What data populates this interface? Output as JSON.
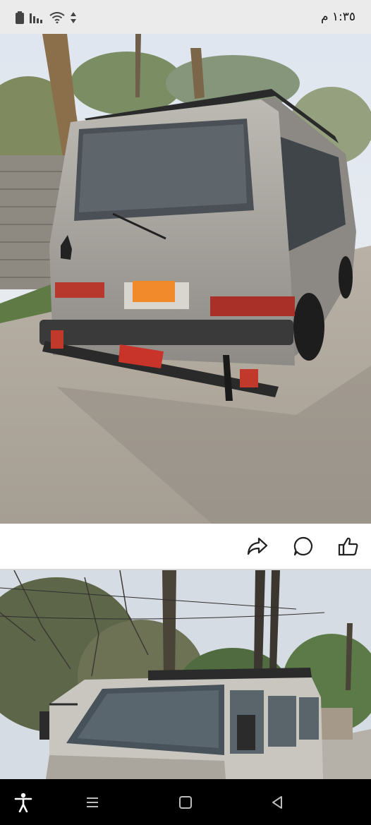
{
  "status_bar": {
    "time": "١:٣٥ م",
    "icons": [
      "battery-icon",
      "signal-icon",
      "wifi-icon",
      "data-arrows-icon"
    ]
  },
  "post_actions": {
    "icons": [
      "share-icon",
      "comment-icon",
      "like-icon"
    ]
  },
  "nav_bar": {
    "icons": [
      "accessibility-icon",
      "recent-apps-icon",
      "home-icon",
      "back-icon"
    ]
  },
  "colors": {
    "status_bar_bg": "#ebebeb",
    "nav_bar_bg": "#000000",
    "icon_color": "#222222",
    "van_silver": "#a9a6a0",
    "plate_orange": "#f08a2a"
  }
}
